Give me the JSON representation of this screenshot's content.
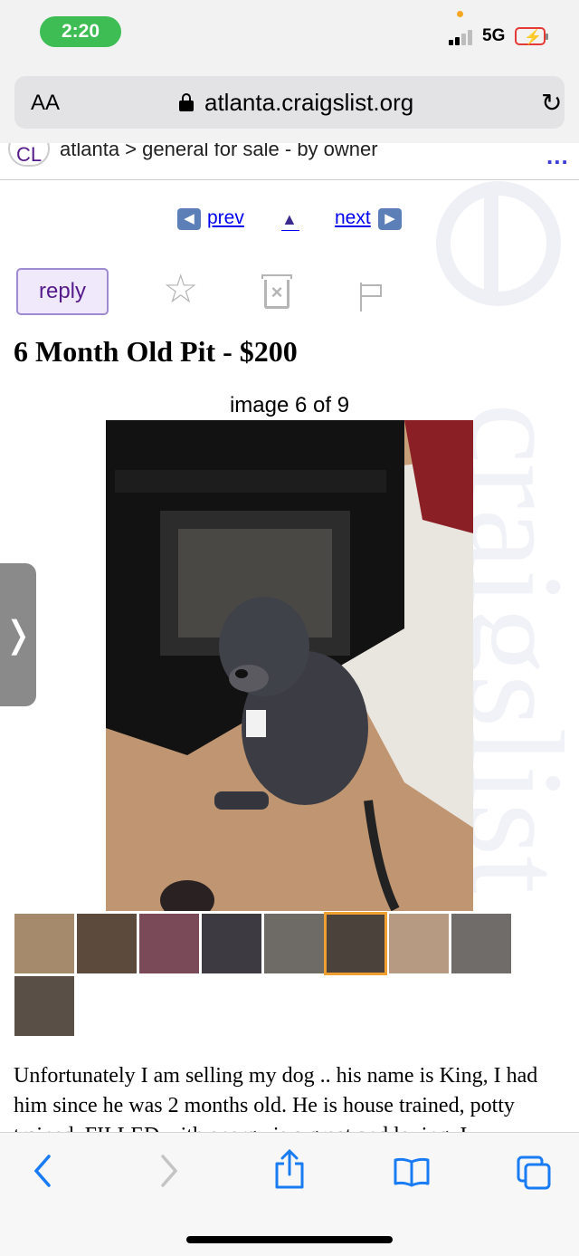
{
  "status": {
    "time": "2:20",
    "network": "5G"
  },
  "browser": {
    "text_size_label": "AA",
    "url": "atlanta.craigslist.org"
  },
  "breadcrumb": {
    "logo": "CL",
    "path": "atlanta > general for sale - by owner",
    "more": "..."
  },
  "nav": {
    "prev": "prev",
    "next": "next"
  },
  "actions": {
    "reply": "reply"
  },
  "posting": {
    "title": "6 Month Old Pit - $200",
    "image_counter": "image 6 of 9",
    "body": "Unfortunately I am selling my dog .. his name is King, I had him since he was 2 months old. He is house trained, potty trained, FILLED with energy is a great and loving. I"
  },
  "gallery": {
    "thumb_count": 9,
    "active_index": 5
  },
  "watermark": "craigslist",
  "colors": {
    "status_green": "#3dbd54",
    "link_blue": "#0000ee",
    "reply_purple": "#551a8b",
    "active_thumb": "#f0a030"
  },
  "toolbar_icons": [
    "back-icon",
    "forward-icon",
    "share-icon",
    "bookmarks-icon",
    "tabs-icon"
  ]
}
